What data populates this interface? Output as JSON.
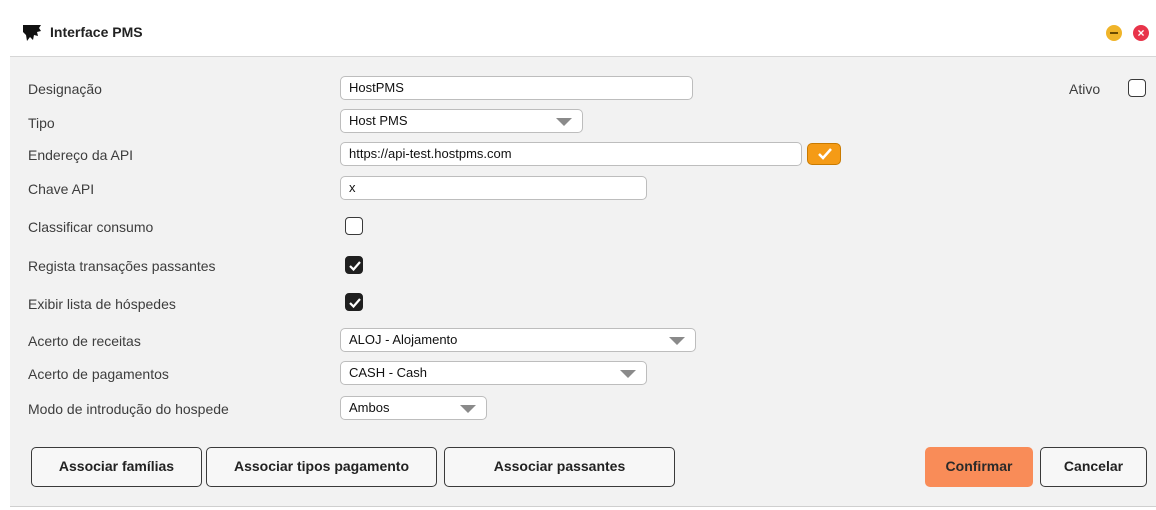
{
  "window": {
    "title": "Interface PMS",
    "close_glyph": "×"
  },
  "form": {
    "designacao": {
      "label": "Designação",
      "value": "HostPMS"
    },
    "ativo": {
      "label": "Ativo",
      "checked": false
    },
    "tipo": {
      "label": "Tipo",
      "value": "Host PMS"
    },
    "endereco_api": {
      "label": "Endereço da API",
      "value": "https://api-test.hostpms.com"
    },
    "chave_api": {
      "label": "Chave API",
      "value": "x"
    },
    "classificar_consumo": {
      "label": "Classificar consumo",
      "checked": false
    },
    "regista_transacoes": {
      "label": "Regista transações passantes",
      "checked": true
    },
    "exibir_hospedes": {
      "label": "Exibir lista de hóspedes",
      "checked": true
    },
    "acerto_receitas": {
      "label": "Acerto de receitas",
      "value": "ALOJ - Alojamento"
    },
    "acerto_pagamentos": {
      "label": "Acerto de pagamentos",
      "value": "CASH - Cash"
    },
    "modo_introducao": {
      "label": "Modo de introdução do hospede",
      "value": "Ambos"
    }
  },
  "buttons": {
    "associar_familias": "Associar famílias",
    "associar_tipos_pagamento": "Associar tipos pagamento",
    "associar_passantes": "Associar passantes",
    "confirmar": "Confirmar",
    "cancelar": "Cancelar"
  },
  "colors": {
    "accent_orange": "#f59b16",
    "confirm_button": "#f98c58",
    "close_red": "#e8344a",
    "minimize_yellow": "#f0b429"
  }
}
